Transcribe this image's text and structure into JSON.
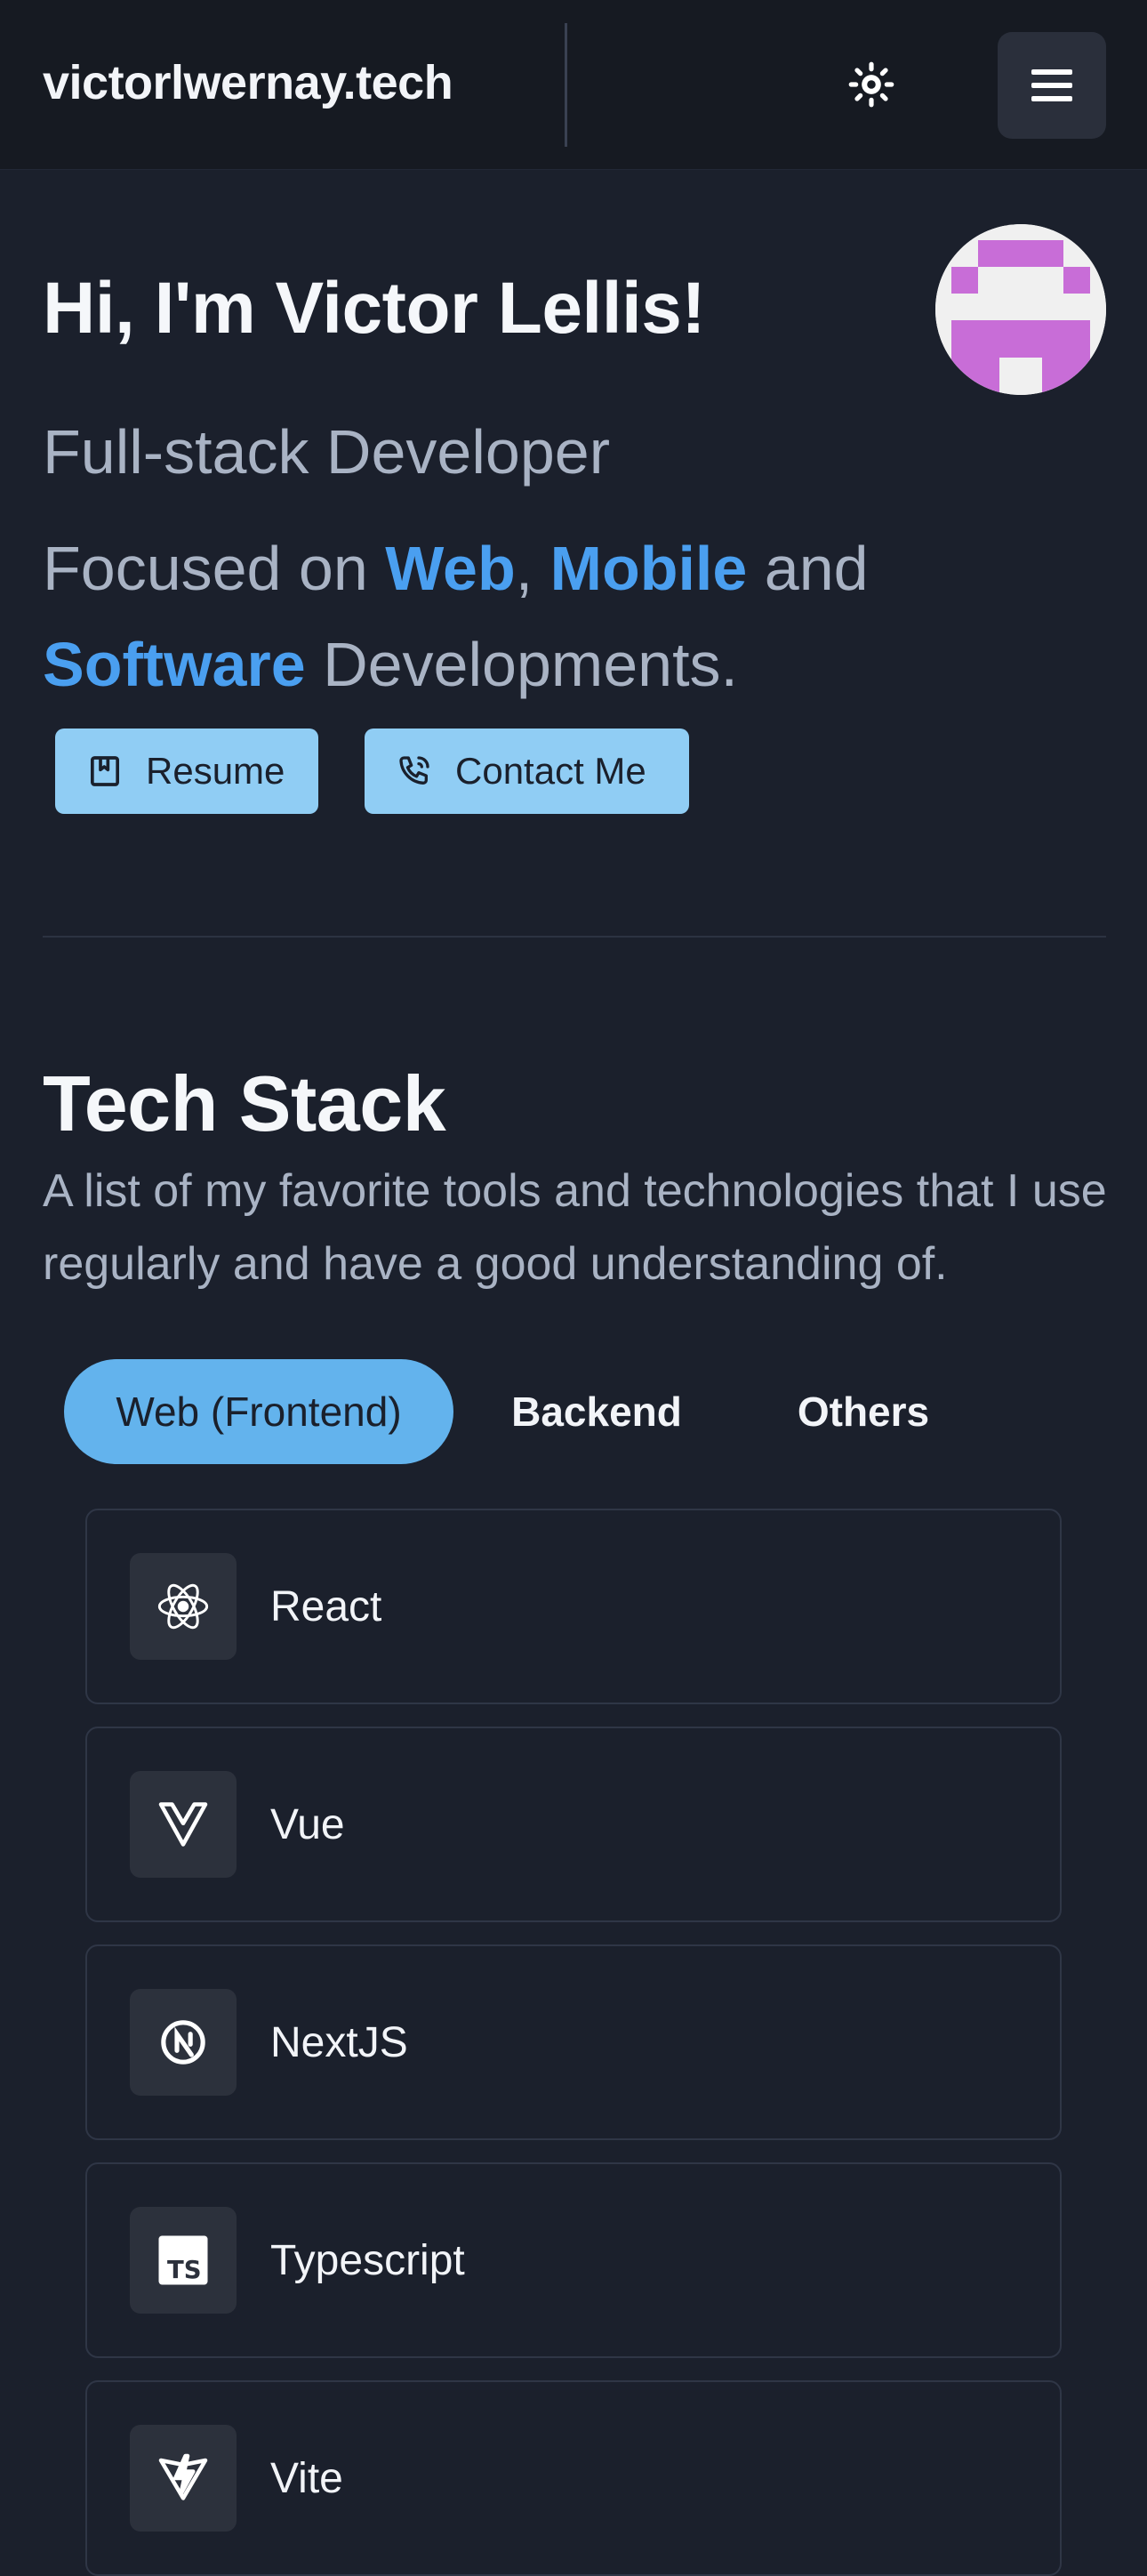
{
  "header": {
    "brand": "victorlwernay.tech",
    "theme_icon": "sun-icon",
    "menu_icon": "hamburger-menu-icon"
  },
  "hero": {
    "title": "Hi, I'm Victor Lellis!",
    "role": "Full-stack Developer",
    "focus": {
      "prefix": "Focused on ",
      "web": "Web",
      "comma": ", ",
      "mobile": "Mobile",
      "and": " and ",
      "software": "Software",
      "suffix": " Developments."
    },
    "resume_label": "Resume",
    "contact_label": "Contact Me"
  },
  "tech_stack": {
    "title": "Tech Stack",
    "description": "A list of my favorite tools and technologies that I use regularly and have a good understanding of.",
    "tabs": [
      {
        "label": "Web (Frontend)",
        "active": true
      },
      {
        "label": "Backend",
        "active": false
      },
      {
        "label": "Others",
        "active": false
      }
    ],
    "items": [
      {
        "label": "React",
        "icon": "react-icon"
      },
      {
        "label": "Vue",
        "icon": "vue-icon"
      },
      {
        "label": "NextJS",
        "icon": "nextjs-icon"
      },
      {
        "label": "Typescript",
        "icon": "typescript-icon"
      },
      {
        "label": "Vite",
        "icon": "vite-icon"
      }
    ]
  },
  "colors": {
    "background": "#1b202c",
    "header_bg": "#161a22",
    "accent": "#4a9ff0",
    "button_bg": "#90cdf4",
    "active_tab": "#63b3ed",
    "avatar_pixels": "#c86dd7"
  }
}
